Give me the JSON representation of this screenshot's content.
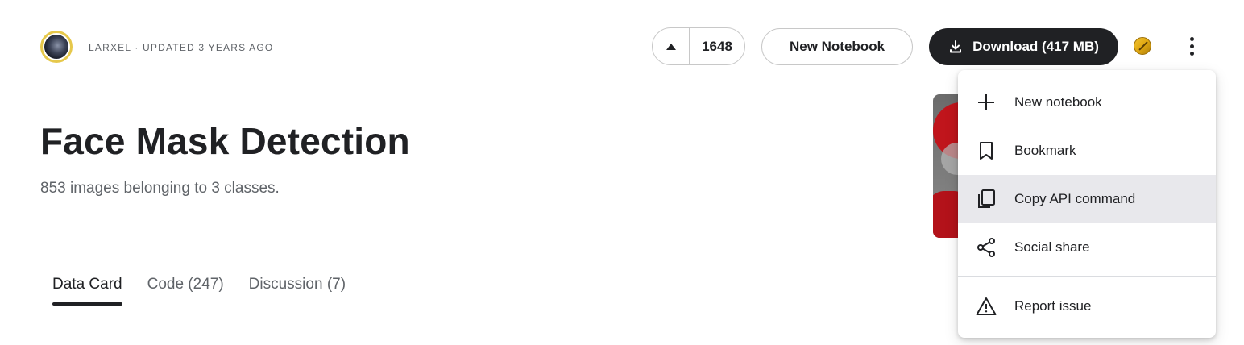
{
  "header": {
    "owner_line": "LARXEL · UPDATED 3 YEARS AGO",
    "vote_count": "1648",
    "new_notebook_label": "New Notebook",
    "download_label": "Download (417 MB)"
  },
  "dataset": {
    "title": "Face Mask Detection",
    "subtitle": "853 images belonging to 3 classes."
  },
  "tabs": [
    {
      "label": "Data Card",
      "active": true
    },
    {
      "label": "Code (247)",
      "active": false
    },
    {
      "label": "Discussion (7)",
      "active": false
    }
  ],
  "menu": {
    "items": [
      {
        "label": "New notebook",
        "icon": "plus-icon"
      },
      {
        "label": "Bookmark",
        "icon": "bookmark-icon"
      },
      {
        "label": "Copy API command",
        "icon": "copy-icon",
        "hovered": true
      },
      {
        "label": "Social share",
        "icon": "share-icon"
      },
      {
        "label": "Report issue",
        "icon": "warning-icon"
      }
    ]
  },
  "colors": {
    "primary_dark": "#202124",
    "medal_gold": "#e0a812",
    "avatar_ring": "#e6c84b",
    "hover_bg": "#e8e8ec"
  }
}
